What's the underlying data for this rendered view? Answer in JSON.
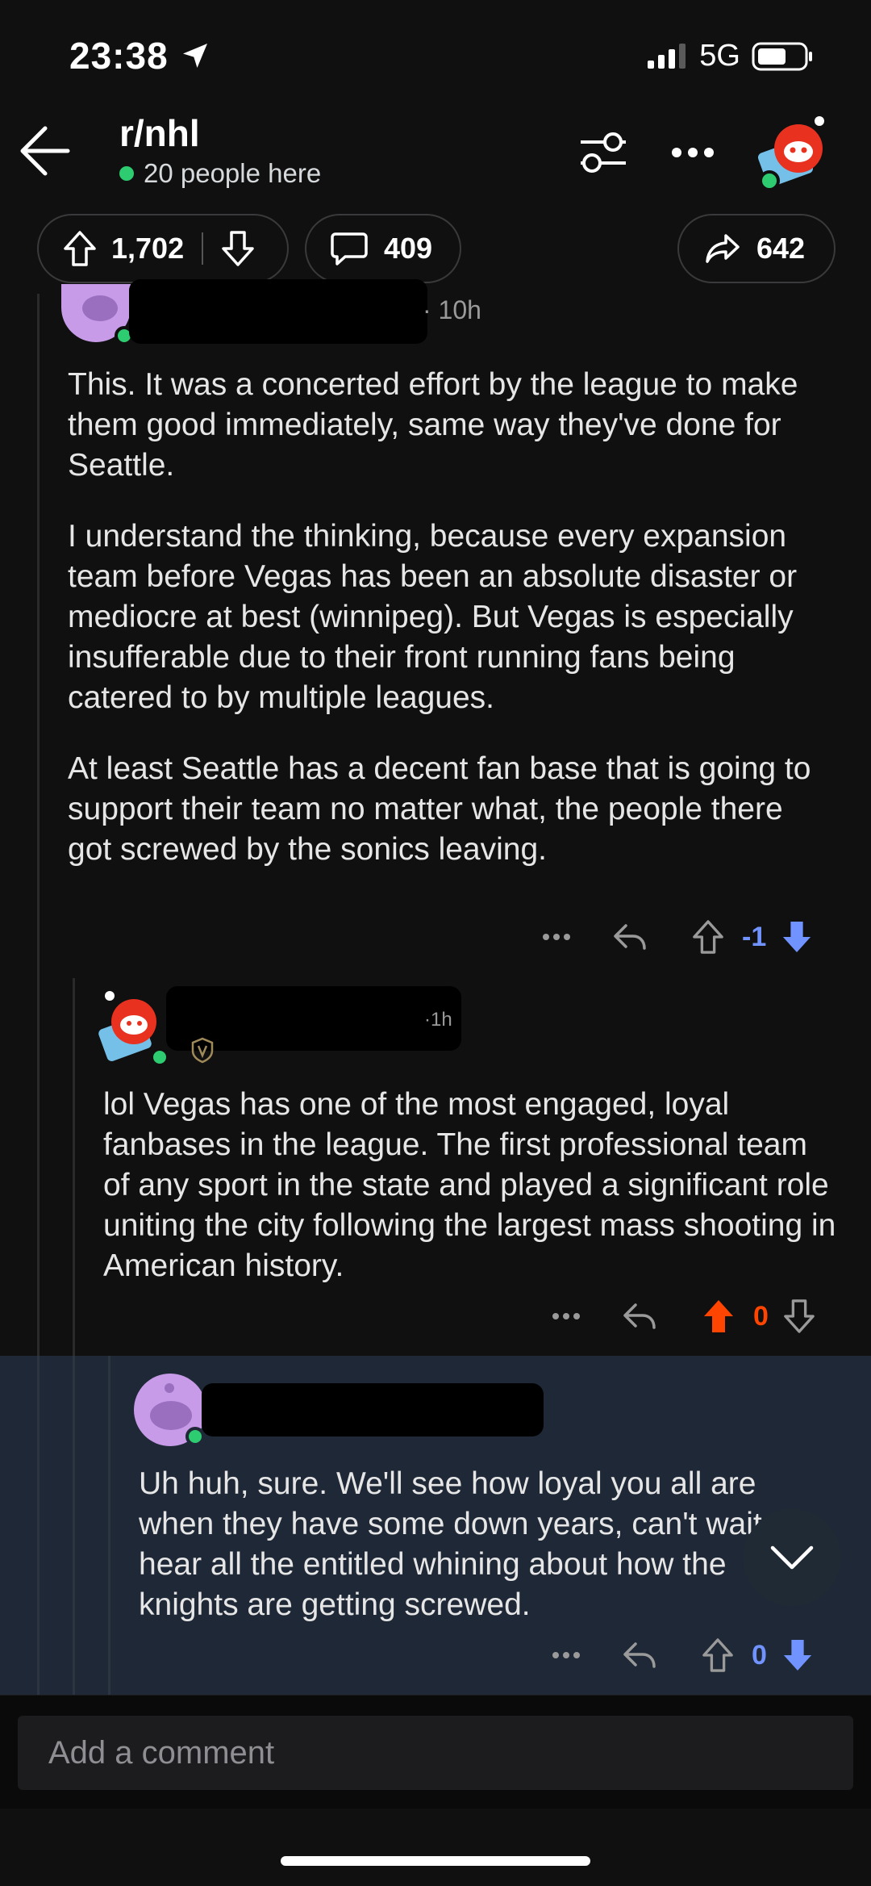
{
  "status_bar": {
    "time": "23:38",
    "network": "5G"
  },
  "header": {
    "subreddit": "r/nhl",
    "online_text": "20 people here"
  },
  "post_actions": {
    "upvotes": "1,702",
    "comments": "409",
    "shares": "642"
  },
  "comments": [
    {
      "age": "· 10h",
      "paragraphs": [
        "This. It was a concerted effort by the league to make them good immediately, same way they've done for Seattle.",
        "I understand the thinking, because every expansion team before Vegas has been an absolute disaster or mediocre at best (winnipeg). But Vegas is especially insufferable due to their front running fans being catered to by multiple leagues.",
        "At least Seattle has a decent fan base that is going to support their team no matter what, the people there got screwed by the sonics leaving."
      ],
      "score": "-1"
    },
    {
      "age": "·1h",
      "paragraphs": [
        "lol Vegas has one of the most engaged, loyal fanbases in the league. The first professional team of any sport in the state and played a significant role uniting the city following the largest mass shooting in American history."
      ],
      "score": "0"
    },
    {
      "age": "",
      "paragraphs": [
        "Uh huh, sure. We'll see how loyal you all are when they have some down years, can't wait to hear all the entitled whining about how the knights are getting screwed."
      ],
      "score": "0"
    }
  ],
  "composer": {
    "placeholder": "Add a comment"
  },
  "colors": {
    "upvote": "#ff4500",
    "downvote": "#7193ff",
    "online": "#2ecc71"
  }
}
